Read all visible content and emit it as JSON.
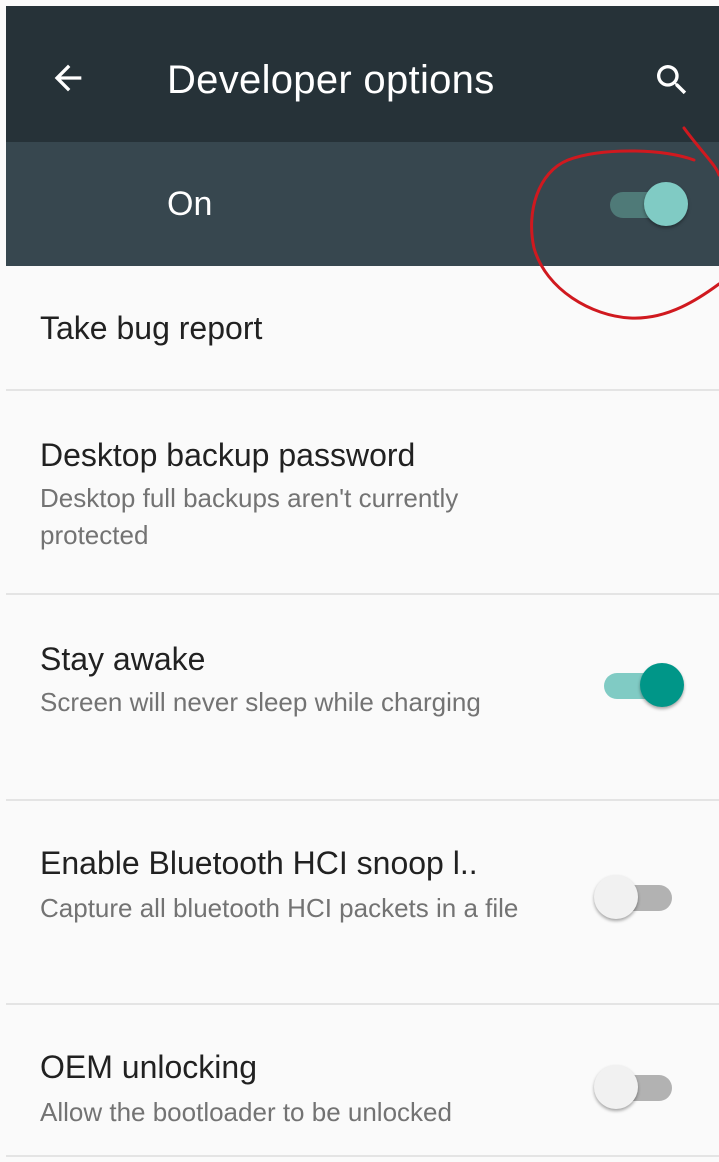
{
  "appbar": {
    "title": "Developer options",
    "back_icon": "arrow-back-icon",
    "search_icon": "search-icon",
    "background": "#263238"
  },
  "master": {
    "label": "On",
    "checked": true,
    "background": "#37474f",
    "track_color": "#4f7a78",
    "thumb_color": "#80cbc4"
  },
  "colors": {
    "accent": "#009688",
    "accent_track": "#80cbc4",
    "off_thumb": "#f1f1f1",
    "off_track": "#b2b2b2",
    "annotation": "#d0191f"
  },
  "settings": [
    {
      "title": "Take bug report"
    },
    {
      "title": "Desktop backup password",
      "summary": "Desktop full backups aren't currently protected"
    },
    {
      "title": "Stay awake",
      "summary": "Screen will never sleep while charging",
      "checked": true
    },
    {
      "title": "Enable Bluetooth HCI snoop l..",
      "summary": "Capture all bluetooth HCI packets in a file",
      "checked": false
    },
    {
      "title": "OEM unlocking",
      "summary": "Allow the bootloader to be unlocked",
      "checked": false
    }
  ]
}
